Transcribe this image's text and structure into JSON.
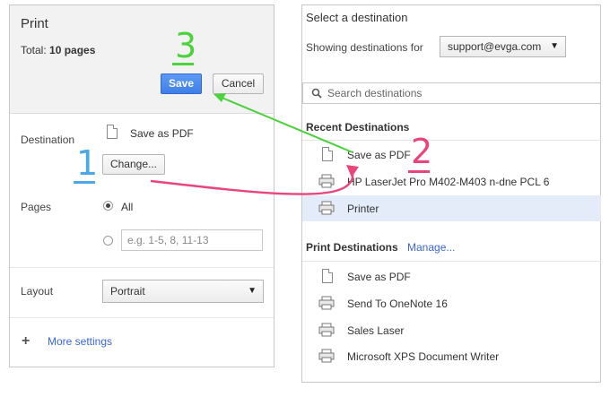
{
  "print": {
    "title": "Print",
    "total_label": "Total:",
    "total_value": "10 pages",
    "save_label": "Save",
    "cancel_label": "Cancel",
    "destination_label": "Destination",
    "destination_value": "Save as PDF",
    "change_label": "Change...",
    "pages_label": "Pages",
    "pages_all_label": "All",
    "pages_custom_placeholder": "e.g. 1-5, 8, 11-13",
    "layout_label": "Layout",
    "layout_value": "Portrait",
    "more_settings_label": "More settings"
  },
  "destination": {
    "title": "Select a destination",
    "showing_label": "Showing destinations for",
    "account": "support@evga.com",
    "search_placeholder": "Search destinations",
    "recent_header": "Recent Destinations",
    "recent": [
      {
        "label": "Save as PDF",
        "icon": "document-icon"
      },
      {
        "label": "HP LaserJet Pro M402-M403 n-dne PCL 6",
        "icon": "printer-icon"
      },
      {
        "label": "Printer",
        "icon": "printer-icon",
        "selected": true
      }
    ],
    "print_header": "Print Destinations",
    "manage_label": "Manage...",
    "print": [
      {
        "label": "Save as PDF",
        "icon": "document-icon"
      },
      {
        "label": "Send To OneNote 16",
        "icon": "printer-icon"
      },
      {
        "label": "Sales Laser",
        "icon": "printer-icon"
      },
      {
        "label": "Microsoft XPS Document Writer",
        "icon": "printer-icon"
      }
    ]
  },
  "annotations": [
    {
      "label": "1",
      "color": "#4aa8e8"
    },
    {
      "label": "2",
      "color": "#e8457a"
    },
    {
      "label": "3",
      "color": "#4cd23c"
    }
  ],
  "colors": {
    "save_button": "#4285f4",
    "selected_row": "#e3ecf8",
    "link": "#3b66d6"
  }
}
